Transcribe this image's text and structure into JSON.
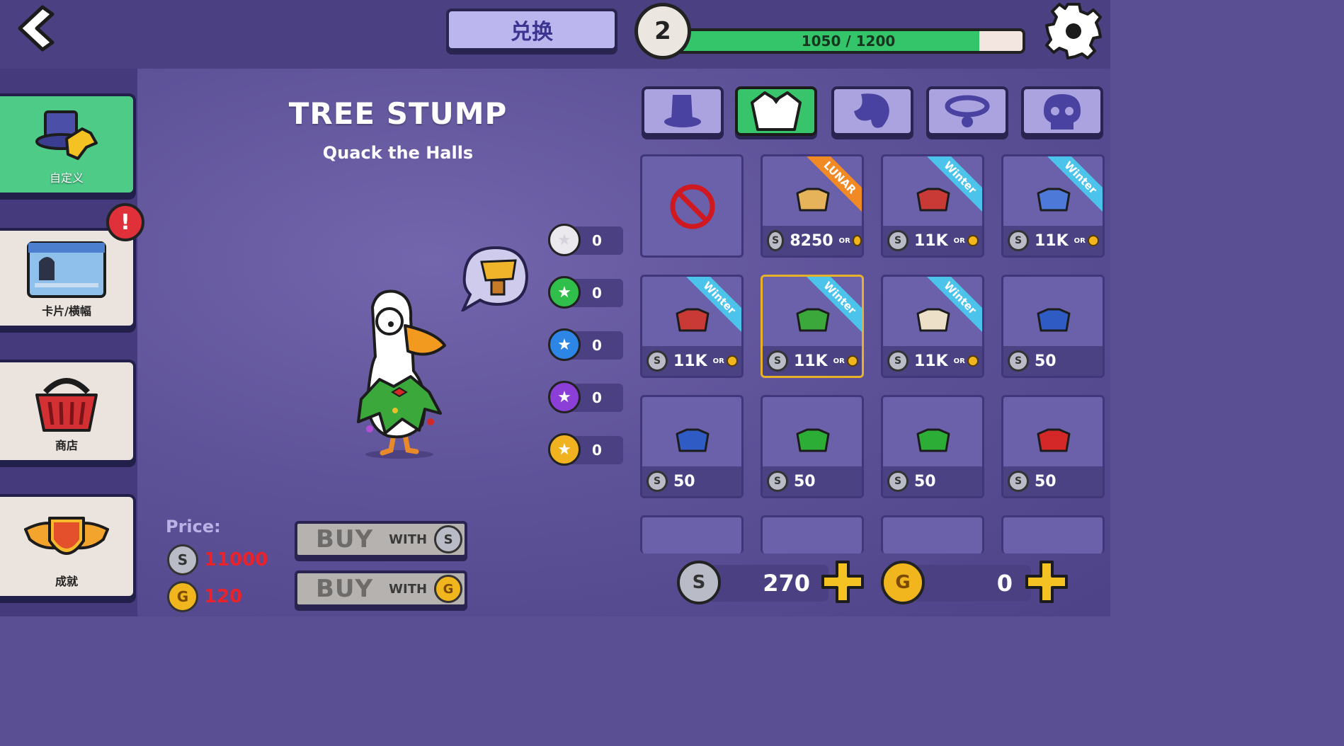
{
  "header": {
    "title": "兑换",
    "level": "2",
    "xp_text": "1050 / 1200",
    "xp_fraction": 0.875
  },
  "sidebar": {
    "items": [
      {
        "label": "自定义",
        "active": true
      },
      {
        "label": "卡片/横幅",
        "active": false,
        "alert": "!"
      },
      {
        "label": "商店",
        "active": false
      },
      {
        "label": "成就",
        "active": false
      }
    ]
  },
  "item": {
    "name": "TREE STUMP",
    "set": "Quack the Halls"
  },
  "token_counts": [
    {
      "icon": "white-star-token-icon",
      "color": "#ece9ee",
      "value": "0"
    },
    {
      "icon": "green-star-token-icon",
      "color": "#2fbf4a",
      "value": "0"
    },
    {
      "icon": "blue-star-token-icon",
      "color": "#2d86e6",
      "value": "0"
    },
    {
      "icon": "purple-star-token-icon",
      "color": "#8c3fd6",
      "value": "0"
    },
    {
      "icon": "gold-star-token-icon",
      "color": "#f0b21e",
      "value": "0"
    }
  ],
  "price": {
    "label": "Price:",
    "silver": "11000",
    "gold": "120"
  },
  "buttons": {
    "buy_text": "BUY",
    "with_text": "WITH"
  },
  "tabs": [
    {
      "icon": "top-hat-icon",
      "active": false
    },
    {
      "icon": "outfit-icon",
      "active": true
    },
    {
      "icon": "hair-icon",
      "active": false
    },
    {
      "icon": "collar-icon",
      "active": false
    },
    {
      "icon": "skull-mask-icon",
      "active": false
    }
  ],
  "grid": {
    "or_label": "OR",
    "cells": [
      {
        "name": "none",
        "cost": "",
        "or_gold": false,
        "ribbon": ""
      },
      {
        "name": "cat-costume",
        "cost": "8250",
        "or_gold": true,
        "ribbon": "LUNAR"
      },
      {
        "name": "red-sweater",
        "cost": "11K",
        "or_gold": true,
        "ribbon": "Winter"
      },
      {
        "name": "blue-sweater",
        "cost": "11K",
        "or_gold": true,
        "ribbon": "Winter"
      },
      {
        "name": "red-knit",
        "cost": "11K",
        "or_gold": true,
        "ribbon": "Winter"
      },
      {
        "name": "tree-stump",
        "cost": "11K",
        "or_gold": true,
        "ribbon": "Winter",
        "selected": true
      },
      {
        "name": "cream-knit",
        "cost": "11K",
        "or_gold": true,
        "ribbon": "Winter"
      },
      {
        "name": "blue-shirt",
        "cost": "50",
        "or_gold": false,
        "ribbon": ""
      },
      {
        "name": "blue-scarf",
        "cost": "50",
        "or_gold": false,
        "ribbon": ""
      },
      {
        "name": "green-shirt",
        "cost": "50",
        "or_gold": false,
        "ribbon": ""
      },
      {
        "name": "green-scarf",
        "cost": "50",
        "or_gold": false,
        "ribbon": ""
      },
      {
        "name": "red-shirt",
        "cost": "50",
        "or_gold": false,
        "ribbon": ""
      }
    ]
  },
  "wallet": {
    "silver": "270",
    "gold": "0"
  },
  "colors": {
    "accent_green": "#37c46b",
    "price_red": "#e8232c",
    "ribbon_winter": "#4cc3ea",
    "ribbon_lunar": "#f18a24"
  }
}
